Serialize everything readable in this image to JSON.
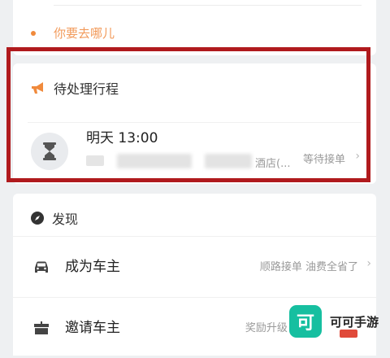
{
  "destination": {
    "placeholder": "你要去哪儿"
  },
  "pending": {
    "title": "待处理行程",
    "trip": {
      "time": "明天 13:00",
      "address_visible": "酒店(...",
      "status": "等待接单",
      "chevron": "›"
    }
  },
  "discover": {
    "title": "发现",
    "items": [
      {
        "label": "成为车主",
        "hint": "顺路接单 油费全省了",
        "chevron": "›",
        "icon": "car-icon"
      },
      {
        "label": "邀请车主",
        "hint": "奖励升级 立",
        "chevron": "",
        "icon": "gift-box-icon"
      }
    ]
  },
  "watermark": {
    "text": "可可手游",
    "logo_glyph": "可"
  },
  "colors": {
    "accent_orange": "#f08a3c",
    "highlight_red": "#b01a1d",
    "watermark_teal": "#16bfa0"
  }
}
